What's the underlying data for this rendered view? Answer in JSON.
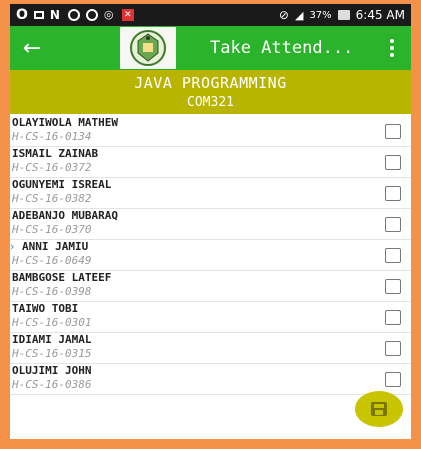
{
  "statusbar": {
    "battery": "37%",
    "time": "6:45 AM"
  },
  "toolbar": {
    "title": "Take Attend..."
  },
  "course": {
    "name": "JAVA PROGRAMMING",
    "code": "COM321"
  },
  "students": [
    {
      "name": "OLAYIWOLA MATHEW",
      "matric": "H-CS-16-0134"
    },
    {
      "name": "ISMAIL ZAINAB",
      "matric": "H-CS-16-0372"
    },
    {
      "name": "OGUNYEMI ISREAL",
      "matric": "H-CS-16-0382"
    },
    {
      "name": "ADEBANJO MUBARAQ",
      "matric": "H-CS-16-0370"
    },
    {
      "name": "ANNI JAMIU",
      "matric": "H-CS-16-0649"
    },
    {
      "name": "BAMBGOSE LATEEF",
      "matric": "H-CS-16-0398"
    },
    {
      "name": "TAIWO TOBI",
      "matric": "H-CS-16-0301"
    },
    {
      "name": "IDIAMI JAMAL",
      "matric": "H-CS-16-0315"
    },
    {
      "name": "OLUJIMI JOHN",
      "matric": "H-CS-16-0386"
    }
  ],
  "icons": {
    "back": "arrow-left-icon",
    "menu": "more-vertical-icon",
    "save": "save-icon"
  },
  "colors": {
    "toolbar": "#2bb32b",
    "course_header": "#b8b400",
    "fab": "#c9c400",
    "frame": "#f5924a"
  }
}
